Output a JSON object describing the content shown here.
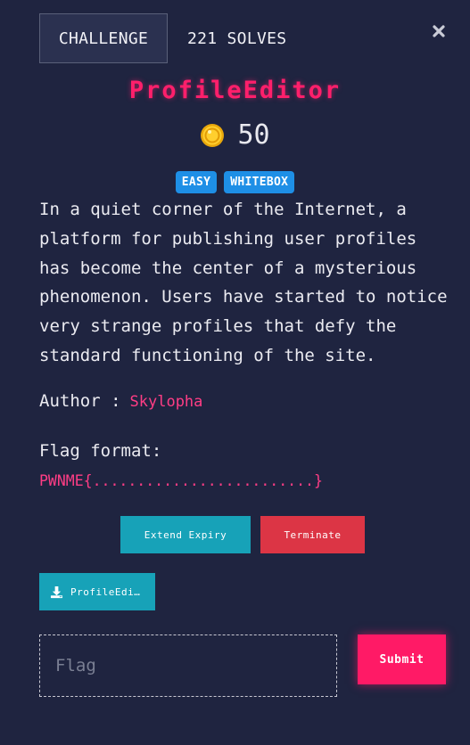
{
  "tabs": {
    "challenge": "CHALLENGE",
    "solves": "221 SOLVES"
  },
  "challenge": {
    "title": "ProfileEditor",
    "value": "50",
    "tags": [
      "EASY",
      "WHITEBOX"
    ],
    "description": "In a quiet corner of the Internet, a platform for publishing user profiles has become the center of a mysterious phenomenon. Users have started to notice very strange profiles that defy the standard functioning of the site.",
    "author_label": "Author :",
    "author_name": "Skylopha",
    "flag_format_label": "Flag format:",
    "flag_format": "PWNME{.........................}"
  },
  "actions": {
    "extend_label": "Extend Expiry",
    "terminate_label": "Terminate",
    "download_label": "ProfileEditor.zip"
  },
  "submission": {
    "placeholder": "Flag",
    "submit_label": "Submit"
  },
  "icons": {
    "close": "close-icon",
    "coin": "coin-icon",
    "download": "download-icon"
  },
  "colors": {
    "background": "#1f2440",
    "title": "#ff1f6b",
    "tag": "#1e8fe6",
    "author": "#ff3d85",
    "extend": "#17a2b8",
    "terminate": "#dc3545",
    "submit": "#ff1a66"
  }
}
